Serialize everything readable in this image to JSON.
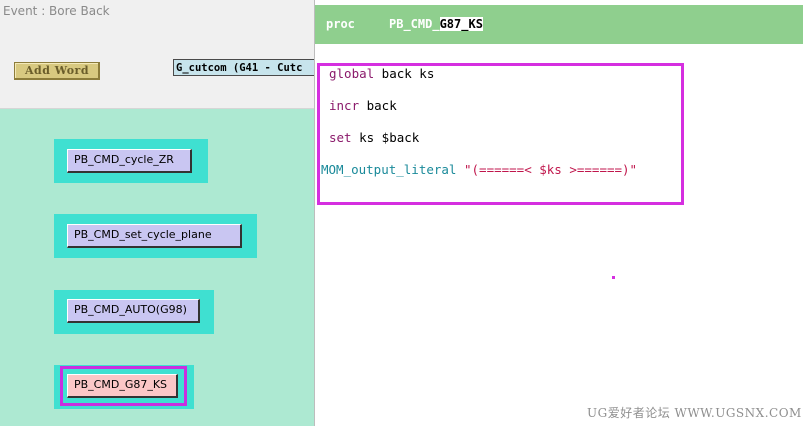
{
  "window": {
    "title": "Event : Bore Back"
  },
  "toolbar": {
    "add_word_label": "Add Word",
    "cutcom_value": "G_cutcom (G41 - Cutc"
  },
  "nodes": [
    {
      "label": "PB_CMD_cycle_ZR",
      "active": false
    },
    {
      "label": "PB_CMD_set_cycle_plane",
      "active": false
    },
    {
      "label": "PB_CMD_AUTO(G98)",
      "active": false
    },
    {
      "label": "PB_CMD_G87_KS",
      "active": true
    }
  ],
  "editor": {
    "proc_keyword": "proc",
    "proc_name_prefix": "PB_CMD_",
    "proc_name_suffix": "G87_KS",
    "lines": [
      {
        "kw": "global",
        "rest": " back ks"
      },
      {
        "kw": "incr",
        "rest": " back"
      },
      {
        "kw": "set",
        "rest": " ks $back"
      },
      {
        "func": "MOM_output_literal",
        "str": " \"(======< $ks >======)\""
      }
    ]
  },
  "watermark": "UG爱好者论坛 WWW.UGSNX.COM",
  "colors": {
    "canvas_bg": "#ade9d2",
    "node_frame": "#3fe0d1",
    "node_button": "#c9c6f2",
    "node_button_active": "#fbc7c7",
    "highlight": "#d52fe0",
    "header_bg": "#8fcf8e"
  }
}
